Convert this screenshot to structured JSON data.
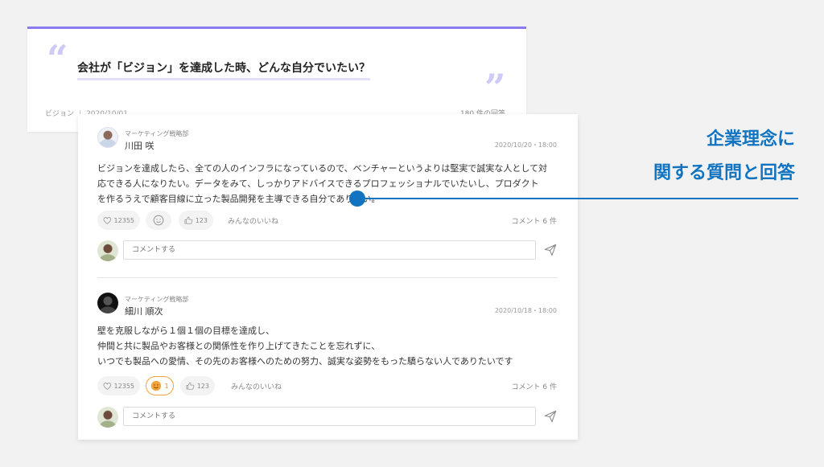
{
  "question": {
    "open_quote": "“",
    "close_quote": "”",
    "title": "会社が「ビジョン」を達成した時、どんな自分でいたい？",
    "category": "ビジョン",
    "separator": "|",
    "date": "2020/10/01",
    "answer_count": "180 件の回答"
  },
  "answers": [
    {
      "department": "マーケティング戦略部",
      "name": "川田 咲",
      "date": "2020/10/20・18:00",
      "lines": [
        "ビジョンを達成したら、全ての人のインフラになっているので、ベンチャーというよりは堅実で誠実な人として対",
        "応できる人になりたい。データをみて、しっかりアドバイスできるプロフェッショナルでいたいし、プロダクト",
        "を作るうえで顧客目線に立った製品開発を主導できる自分でありたい。"
      ],
      "likes": "12355",
      "emoji_count": "",
      "thumbs": "123",
      "everyone_likes": "みんなのいいね",
      "comment_count": "コメント 6 件",
      "comment_placeholder": "コメントする"
    },
    {
      "department": "マーケティング戦略部",
      "name": "細川 順次",
      "date": "2020/10/18・18:00",
      "lines": [
        "壁を克服しながら１個１個の目標を達成し、",
        "仲間と共に製品やお客様との関係性を作り上げてきたことを忘れずに、",
        "いつでも製品への愛情、その先のお客様へのための努力、誠実な姿勢をもった驕らない人でありたいです"
      ],
      "likes": "12355",
      "emoji_count": "1",
      "thumbs": "123",
      "everyone_likes": "みんなのいいね",
      "comment_count": "コメント 6 件",
      "comment_placeholder": "コメントする"
    }
  ],
  "callout": {
    "line1": "企業理念に",
    "line2": "関する質問と回答"
  },
  "colors": {
    "accent_purple": "#8a7cf0",
    "callout_blue": "#1274c0",
    "emoji_orange": "#f0a43a"
  },
  "icons": [
    "heart-icon",
    "smile-icon",
    "thumbs-up-icon",
    "send-icon"
  ]
}
